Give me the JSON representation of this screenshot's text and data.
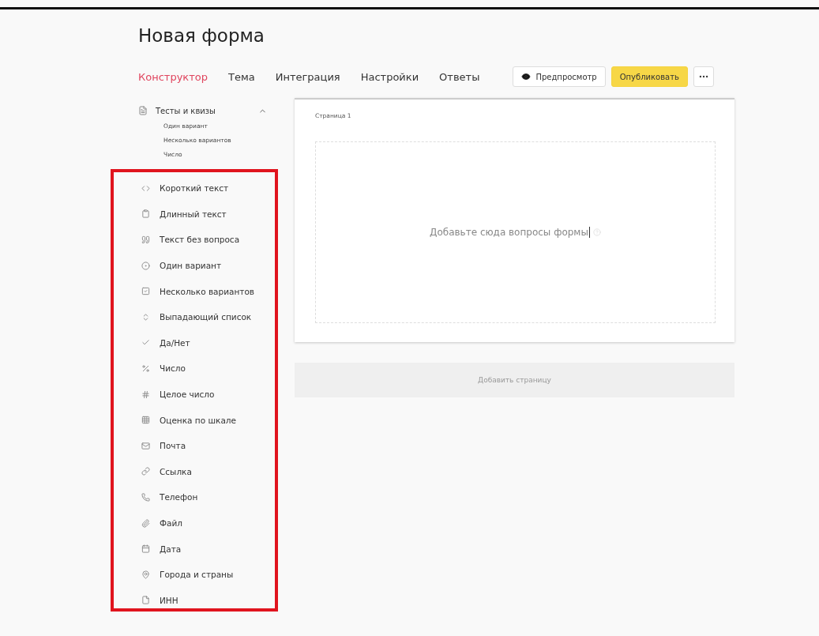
{
  "title": "Новая форма",
  "tabs": [
    {
      "label": "Конструктор",
      "selected": true
    },
    {
      "label": "Тема",
      "selected": false
    },
    {
      "label": "Интеграция",
      "selected": false
    },
    {
      "label": "Настройки",
      "selected": false
    },
    {
      "label": "Ответы",
      "selected": false
    }
  ],
  "actions": {
    "preview": "Предпросмотр",
    "publish": "Опубликовать"
  },
  "sidebar": {
    "group": {
      "label": "Тесты и квизы",
      "expanded": true,
      "children": [
        {
          "label": "Один вариант"
        },
        {
          "label": "Несколько вариантов"
        },
        {
          "label": "Число"
        }
      ]
    },
    "items": [
      {
        "label": "Короткий текст"
      },
      {
        "label": "Длинный текст"
      },
      {
        "label": "Текст без вопроса"
      },
      {
        "label": "Один вариант"
      },
      {
        "label": "Несколько вариантов"
      },
      {
        "label": "Выпадающий список"
      },
      {
        "label": "Да/Нет"
      },
      {
        "label": "Число"
      },
      {
        "label": "Целое число"
      },
      {
        "label": "Оценка по шкале"
      },
      {
        "label": "Почта"
      },
      {
        "label": "Ссылка"
      },
      {
        "label": "Телефон"
      },
      {
        "label": "Файл"
      },
      {
        "label": "Дата"
      },
      {
        "label": "Города и страны"
      },
      {
        "label": "ИНН"
      }
    ]
  },
  "page": {
    "title": "Страница 1",
    "dropzone": "Добавьте сюда вопросы формы",
    "add_page": "Добавить страницу"
  }
}
